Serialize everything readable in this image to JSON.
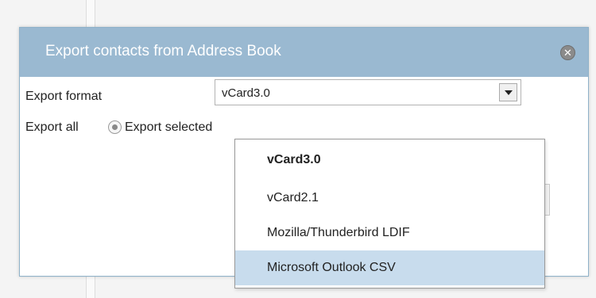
{
  "dialog": {
    "title": "Export contacts from Address Book",
    "close_glyph": "✕"
  },
  "form": {
    "format_label": "Export format",
    "export_all_label": "Export all",
    "export_selected_label": "Export selected",
    "selected_format": "vCard3.0"
  },
  "dropdown": {
    "options": [
      {
        "label": "vCard3.0"
      },
      {
        "label": "vCard2.1"
      },
      {
        "label": "Mozilla/Thunderbird LDIF"
      },
      {
        "label": "Microsoft Outlook CSV"
      }
    ]
  },
  "colors": {
    "header_bg": "#9ab9d1",
    "highlight": "#c8dced"
  },
  "icons": {
    "close": "close-icon",
    "arrow": "chevron-down-icon",
    "radio": "radio-selected-icon"
  }
}
